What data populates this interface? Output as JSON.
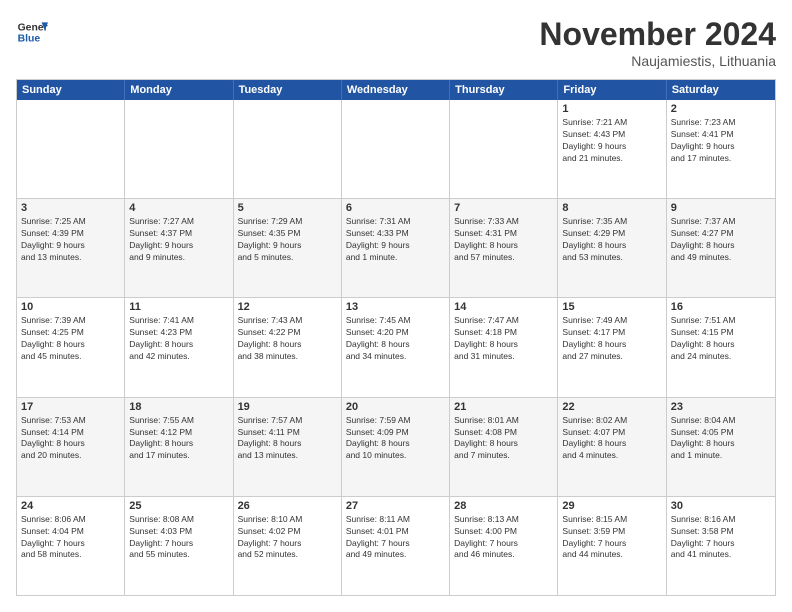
{
  "header": {
    "logo_line1": "General",
    "logo_line2": "Blue",
    "month_title": "November 2024",
    "location": "Naujamiestis, Lithuania"
  },
  "weekdays": [
    "Sunday",
    "Monday",
    "Tuesday",
    "Wednesday",
    "Thursday",
    "Friday",
    "Saturday"
  ],
  "rows": [
    {
      "alt": false,
      "cells": [
        {
          "day": "",
          "info": ""
        },
        {
          "day": "",
          "info": ""
        },
        {
          "day": "",
          "info": ""
        },
        {
          "day": "",
          "info": ""
        },
        {
          "day": "",
          "info": ""
        },
        {
          "day": "1",
          "info": "Sunrise: 7:21 AM\nSunset: 4:43 PM\nDaylight: 9 hours\nand 21 minutes."
        },
        {
          "day": "2",
          "info": "Sunrise: 7:23 AM\nSunset: 4:41 PM\nDaylight: 9 hours\nand 17 minutes."
        }
      ]
    },
    {
      "alt": true,
      "cells": [
        {
          "day": "3",
          "info": "Sunrise: 7:25 AM\nSunset: 4:39 PM\nDaylight: 9 hours\nand 13 minutes."
        },
        {
          "day": "4",
          "info": "Sunrise: 7:27 AM\nSunset: 4:37 PM\nDaylight: 9 hours\nand 9 minutes."
        },
        {
          "day": "5",
          "info": "Sunrise: 7:29 AM\nSunset: 4:35 PM\nDaylight: 9 hours\nand 5 minutes."
        },
        {
          "day": "6",
          "info": "Sunrise: 7:31 AM\nSunset: 4:33 PM\nDaylight: 9 hours\nand 1 minute."
        },
        {
          "day": "7",
          "info": "Sunrise: 7:33 AM\nSunset: 4:31 PM\nDaylight: 8 hours\nand 57 minutes."
        },
        {
          "day": "8",
          "info": "Sunrise: 7:35 AM\nSunset: 4:29 PM\nDaylight: 8 hours\nand 53 minutes."
        },
        {
          "day": "9",
          "info": "Sunrise: 7:37 AM\nSunset: 4:27 PM\nDaylight: 8 hours\nand 49 minutes."
        }
      ]
    },
    {
      "alt": false,
      "cells": [
        {
          "day": "10",
          "info": "Sunrise: 7:39 AM\nSunset: 4:25 PM\nDaylight: 8 hours\nand 45 minutes."
        },
        {
          "day": "11",
          "info": "Sunrise: 7:41 AM\nSunset: 4:23 PM\nDaylight: 8 hours\nand 42 minutes."
        },
        {
          "day": "12",
          "info": "Sunrise: 7:43 AM\nSunset: 4:22 PM\nDaylight: 8 hours\nand 38 minutes."
        },
        {
          "day": "13",
          "info": "Sunrise: 7:45 AM\nSunset: 4:20 PM\nDaylight: 8 hours\nand 34 minutes."
        },
        {
          "day": "14",
          "info": "Sunrise: 7:47 AM\nSunset: 4:18 PM\nDaylight: 8 hours\nand 31 minutes."
        },
        {
          "day": "15",
          "info": "Sunrise: 7:49 AM\nSunset: 4:17 PM\nDaylight: 8 hours\nand 27 minutes."
        },
        {
          "day": "16",
          "info": "Sunrise: 7:51 AM\nSunset: 4:15 PM\nDaylight: 8 hours\nand 24 minutes."
        }
      ]
    },
    {
      "alt": true,
      "cells": [
        {
          "day": "17",
          "info": "Sunrise: 7:53 AM\nSunset: 4:14 PM\nDaylight: 8 hours\nand 20 minutes."
        },
        {
          "day": "18",
          "info": "Sunrise: 7:55 AM\nSunset: 4:12 PM\nDaylight: 8 hours\nand 17 minutes."
        },
        {
          "day": "19",
          "info": "Sunrise: 7:57 AM\nSunset: 4:11 PM\nDaylight: 8 hours\nand 13 minutes."
        },
        {
          "day": "20",
          "info": "Sunrise: 7:59 AM\nSunset: 4:09 PM\nDaylight: 8 hours\nand 10 minutes."
        },
        {
          "day": "21",
          "info": "Sunrise: 8:01 AM\nSunset: 4:08 PM\nDaylight: 8 hours\nand 7 minutes."
        },
        {
          "day": "22",
          "info": "Sunrise: 8:02 AM\nSunset: 4:07 PM\nDaylight: 8 hours\nand 4 minutes."
        },
        {
          "day": "23",
          "info": "Sunrise: 8:04 AM\nSunset: 4:05 PM\nDaylight: 8 hours\nand 1 minute."
        }
      ]
    },
    {
      "alt": false,
      "cells": [
        {
          "day": "24",
          "info": "Sunrise: 8:06 AM\nSunset: 4:04 PM\nDaylight: 7 hours\nand 58 minutes."
        },
        {
          "day": "25",
          "info": "Sunrise: 8:08 AM\nSunset: 4:03 PM\nDaylight: 7 hours\nand 55 minutes."
        },
        {
          "day": "26",
          "info": "Sunrise: 8:10 AM\nSunset: 4:02 PM\nDaylight: 7 hours\nand 52 minutes."
        },
        {
          "day": "27",
          "info": "Sunrise: 8:11 AM\nSunset: 4:01 PM\nDaylight: 7 hours\nand 49 minutes."
        },
        {
          "day": "28",
          "info": "Sunrise: 8:13 AM\nSunset: 4:00 PM\nDaylight: 7 hours\nand 46 minutes."
        },
        {
          "day": "29",
          "info": "Sunrise: 8:15 AM\nSunset: 3:59 PM\nDaylight: 7 hours\nand 44 minutes."
        },
        {
          "day": "30",
          "info": "Sunrise: 8:16 AM\nSunset: 3:58 PM\nDaylight: 7 hours\nand 41 minutes."
        }
      ]
    }
  ]
}
